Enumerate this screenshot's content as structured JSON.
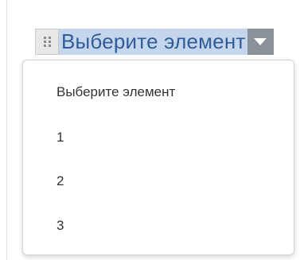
{
  "dropdown": {
    "selected_value": "Выберите элемент",
    "handle_icon": "drag-handle-dots-icon",
    "arrow_icon": "caret-down-icon",
    "colors": {
      "highlight_bg": "#c5d6ec",
      "highlight_text": "#2f5d99",
      "arrow_bg": "#8b9198"
    }
  },
  "menu": {
    "items": [
      {
        "label": "Выберите элемент"
      },
      {
        "label": "1"
      },
      {
        "label": "2"
      },
      {
        "label": "3"
      }
    ]
  }
}
